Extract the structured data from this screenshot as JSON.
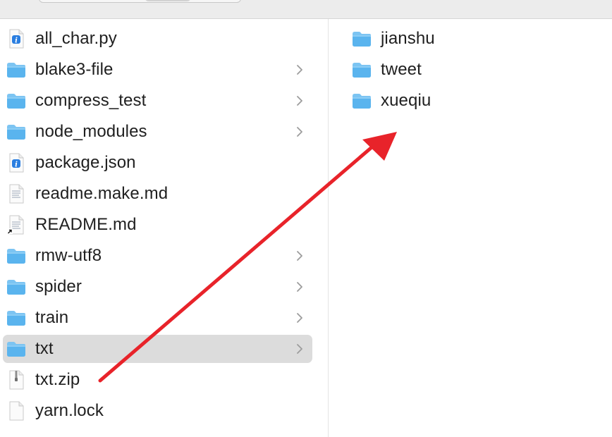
{
  "colors": {
    "folder": "#5ab4ee",
    "selection": "#dcdcdc",
    "annotation_arrow": "#e8232a"
  },
  "column1": {
    "items": [
      {
        "label": "all_char.py",
        "icon": "python-file-icon",
        "has_children": false
      },
      {
        "label": "blake3-file",
        "icon": "folder-icon",
        "has_children": true
      },
      {
        "label": "compress_test",
        "icon": "folder-icon",
        "has_children": true
      },
      {
        "label": "node_modules",
        "icon": "folder-icon",
        "has_children": true
      },
      {
        "label": "package.json",
        "icon": "json-file-icon",
        "has_children": false
      },
      {
        "label": "readme.make.md",
        "icon": "markdown-file-icon",
        "has_children": false
      },
      {
        "label": "README.md",
        "icon": "markdown-alias-file-icon",
        "has_children": false
      },
      {
        "label": "rmw-utf8",
        "icon": "folder-icon",
        "has_children": true
      },
      {
        "label": "spider",
        "icon": "folder-icon",
        "has_children": true
      },
      {
        "label": "train",
        "icon": "folder-icon",
        "has_children": true
      },
      {
        "label": "txt",
        "icon": "folder-icon",
        "has_children": true,
        "selected": true
      },
      {
        "label": "txt.zip",
        "icon": "zip-file-icon",
        "has_children": false
      },
      {
        "label": "yarn.lock",
        "icon": "blank-file-icon",
        "has_children": false
      }
    ]
  },
  "column2": {
    "items": [
      {
        "label": "jianshu",
        "icon": "folder-icon"
      },
      {
        "label": "tweet",
        "icon": "folder-icon"
      },
      {
        "label": "xueqiu",
        "icon": "folder-icon"
      }
    ]
  }
}
